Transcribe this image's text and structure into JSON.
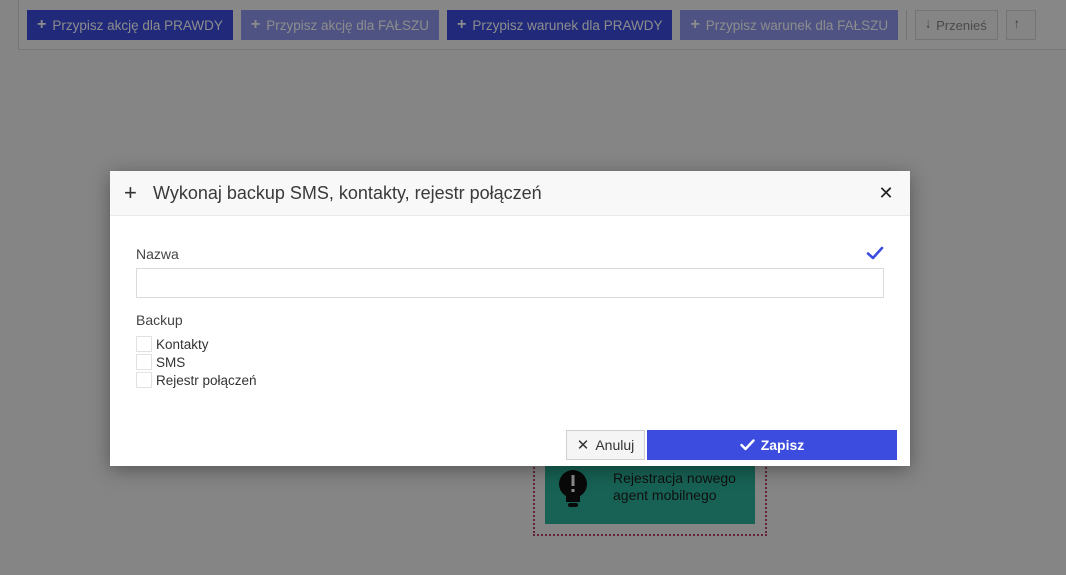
{
  "toolbar": {
    "buttons": [
      {
        "label": "Przypisz akcję dla PRAWDY",
        "style": "primary"
      },
      {
        "label": "Przypisz akcję dla FAŁSZU",
        "style": "light"
      },
      {
        "label": "Przypisz warunek dla PRAWDY",
        "style": "primary"
      },
      {
        "label": "Przypisz warunek dla FAŁSZU",
        "style": "light"
      }
    ],
    "move_label": "Przenieś"
  },
  "flow_node": {
    "label": "Rejestracja nowego agent mobilnego",
    "icon": "lightbulb-alert-icon"
  },
  "modal": {
    "title": "Wykonaj backup SMS, kontakty, rejestr połączeń",
    "name_label": "Nazwa",
    "name_value": "",
    "backup_label": "Backup",
    "options": [
      "Kontakty",
      "SMS",
      "Rejestr połączeń"
    ],
    "cancel_label": "Anuluj",
    "save_label": "Zapisz"
  },
  "colors": {
    "primary": "#3b4cde",
    "primary_light": "#8e98f0",
    "node": "#2bb39a"
  }
}
